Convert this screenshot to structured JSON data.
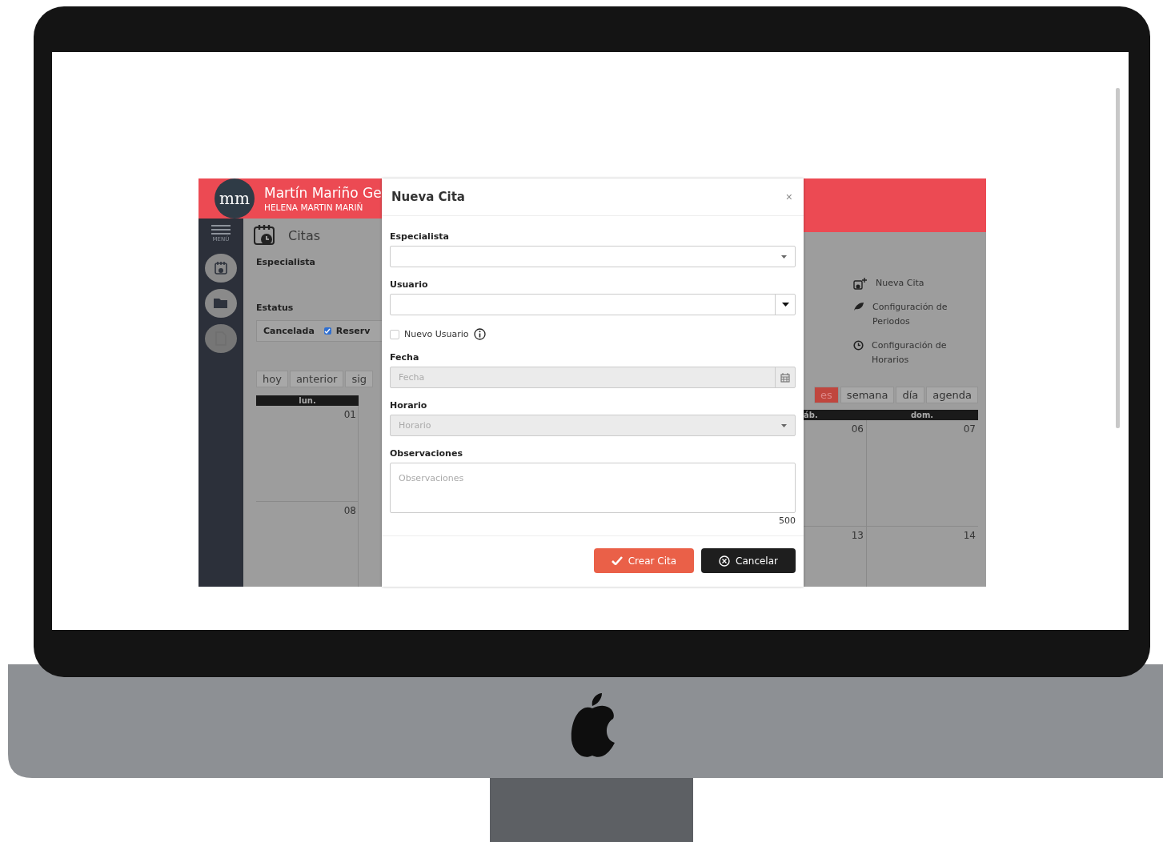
{
  "header": {
    "logo": "mm",
    "title": "Martín Mariño Ge",
    "subtitle": "HELENA MARTIN MARIÑ"
  },
  "sidebar": {
    "menu_label": "MENÚ"
  },
  "page": {
    "title": "Citas",
    "especialista_label": "Especialista",
    "estatus_label": "Estatus",
    "status_options": [
      {
        "kind": "label",
        "label": "Cancelada"
      },
      {
        "kind": "checkbox",
        "label": "Reserv",
        "checked": true
      }
    ],
    "nav_buttons": [
      "hoy",
      "anterior",
      "sig"
    ],
    "calendar_left": {
      "day_header": "lun.",
      "dates": [
        "01",
        "08"
      ]
    }
  },
  "side_actions": [
    {
      "kind": "calendar-plus",
      "label": "Nueva Cita"
    },
    {
      "kind": "leaf",
      "label": "Configuración de Periodos"
    },
    {
      "kind": "clock",
      "label": "Configuración de Horarios"
    }
  ],
  "view_buttons": [
    {
      "label": "es",
      "selected": true
    },
    {
      "label": "semana",
      "selected": false
    },
    {
      "label": "día",
      "selected": false
    },
    {
      "label": "agenda",
      "selected": false
    }
  ],
  "calendar_right": {
    "day_headers": [
      "áb.",
      "dom."
    ],
    "rows": [
      [
        "06",
        "07"
      ],
      [
        "13",
        "14"
      ]
    ]
  },
  "modal": {
    "title": "Nueva Cita",
    "close": "×",
    "fields": [
      {
        "kind": "select",
        "label": "Especialista",
        "disabled": false
      },
      {
        "kind": "select-button",
        "label": "Usuario"
      },
      {
        "kind": "checkbox",
        "label": "Nuevo Usuario",
        "checked": false
      },
      {
        "kind": "date",
        "label": "Fecha",
        "placeholder": "Fecha",
        "disabled": true
      },
      {
        "kind": "select",
        "label": "Horario",
        "placeholder": "Horario",
        "disabled": true
      },
      {
        "kind": "textarea",
        "label": "Observaciones",
        "placeholder": "Observaciones",
        "counter": "500"
      }
    ],
    "buttons": [
      {
        "kind": "primary",
        "label": "Crear Cita"
      },
      {
        "kind": "dark",
        "label": "Cancelar"
      }
    ]
  }
}
